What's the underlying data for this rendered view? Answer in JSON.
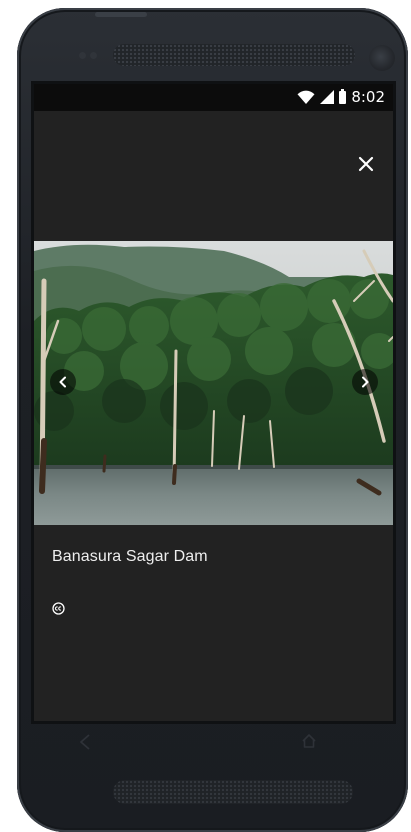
{
  "status_bar": {
    "time": "8:02",
    "icons": [
      "wifi-icon",
      "signal-icon",
      "battery-icon"
    ]
  },
  "viewer": {
    "close_icon": "close-icon",
    "prev_icon": "chevron-left-icon",
    "next_icon": "chevron-right-icon",
    "caption": "Banasura Sagar Dam",
    "license_icon": "creative-commons-icon"
  },
  "device": {
    "softkeys": [
      "back-icon",
      "home-icon"
    ]
  },
  "colors": {
    "screen_bg": "#222222",
    "status_bar_bg": "#0c0c0c",
    "caption_text": "#eeeeee",
    "phone_body": "#1d2025"
  }
}
